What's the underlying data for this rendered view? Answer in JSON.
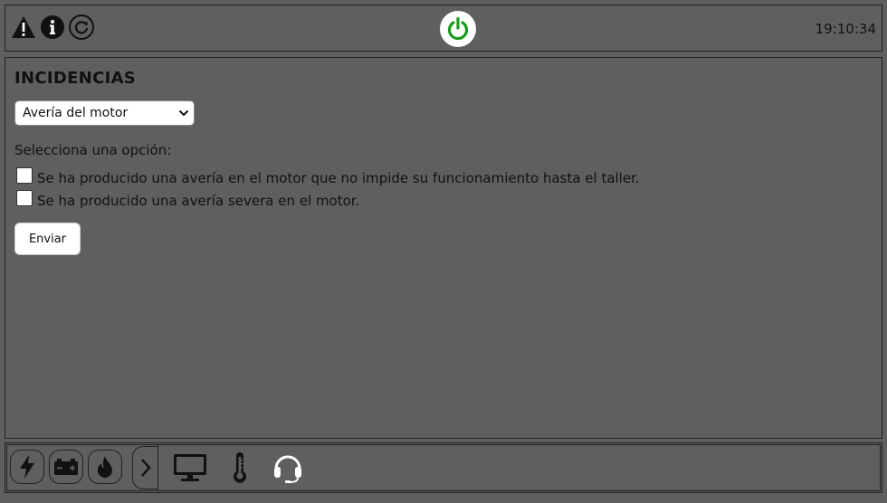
{
  "topbar": {
    "clock": "19:10:34",
    "icons": [
      "warning-icon",
      "info-icon",
      "refresh-icon",
      "power-icon"
    ]
  },
  "panel": {
    "title": "INCIDENCIAS",
    "select_value": "Avería del motor",
    "prompt": "Selecciona una opción:",
    "options": [
      "Se ha producido una avería en el motor que no impide su funcionamiento hasta el taller.",
      "Se ha producido una avería severa en el motor."
    ],
    "send_label": "Enviar"
  },
  "bottombar": {
    "buttons": [
      "lightning-icon",
      "battery-icon",
      "flame-icon"
    ],
    "tools": [
      "monitor-icon",
      "thermometer-icon",
      "headset-icon"
    ]
  },
  "colors": {
    "background": "#5f5f5f",
    "power_green": "#1a9a1a"
  }
}
